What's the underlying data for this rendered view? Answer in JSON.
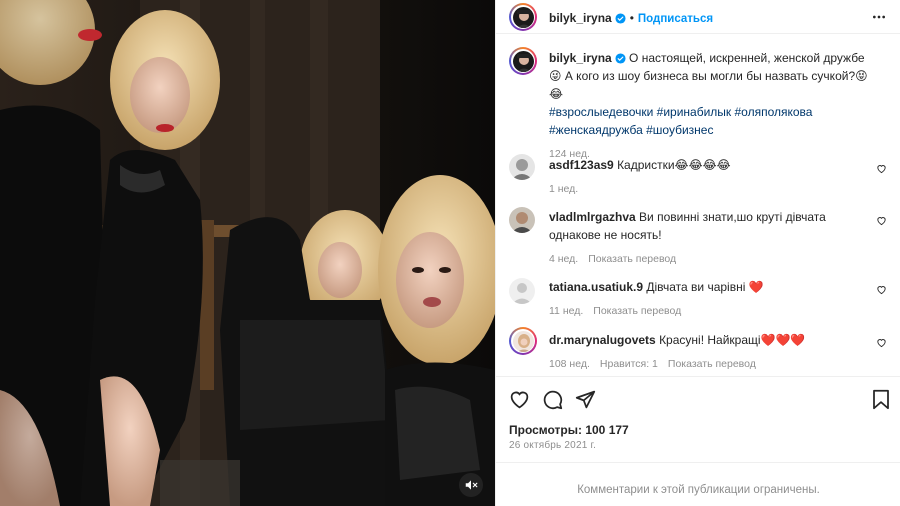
{
  "post": {
    "author": "bilyk_iryna",
    "follow_label": "Подписаться",
    "separator": "•",
    "caption": {
      "text": "О настоящей, искренней, женской дружбе 😜 А кого из шоу бизнеса вы могли бы назвать сучкой?😝😂",
      "hashtags": "#взрослыедевочки #иринабилык #оляполякова #женскаядружба #шоубизнес",
      "time": "124 нед."
    },
    "comments": [
      {
        "user": "asdf123as9",
        "text": "Кадристки😂😂😂😂",
        "time": "1 нед.",
        "translate": ""
      },
      {
        "user": "vladlmlrgazhva",
        "text": "Ви повинні знати,шо круті дівчата однакове не носять!",
        "time": "4 нед.",
        "translate": "Показать перевод"
      },
      {
        "user": "tatiana.usatiuk.9",
        "text": "Дівчата ви чарівні ❤️",
        "time": "11 нед.",
        "translate": "Показать перевод"
      },
      {
        "user": "dr.marynalugovets",
        "text": "Красуні! Найкращі❤️❤️❤️",
        "time": "108 нед.",
        "replies": "Нравится: 1",
        "translate": "Показать перевод"
      }
    ],
    "views_label": "Просмотры: 100 177",
    "date": "26 октябрь 2021 г.",
    "footer": "Комментарии к этой публикации ограничены."
  },
  "colors": {
    "accent": "#0095f6",
    "heart_red": "#ed4956",
    "muted": "#8e8e8e"
  },
  "icons": [
    "verified-icon",
    "more-icon",
    "heart-icon",
    "comment-icon",
    "share-icon",
    "bookmark-icon",
    "mute-icon"
  ]
}
